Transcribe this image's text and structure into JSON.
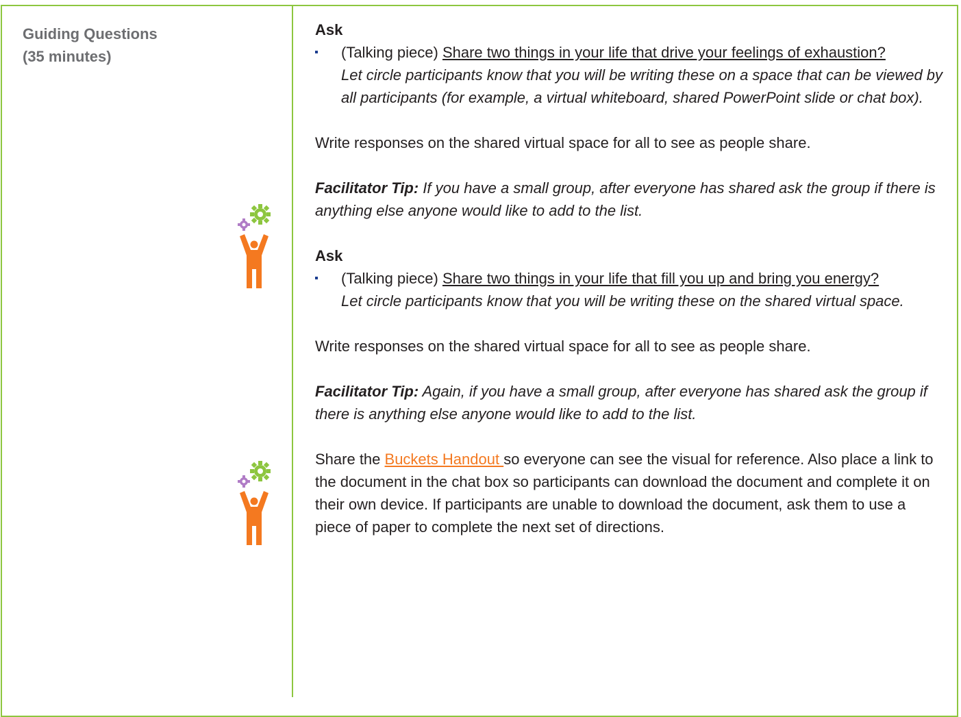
{
  "section": {
    "title": "Guiding Questions",
    "duration": "(35 minutes)"
  },
  "blocks": {
    "ask1": {
      "heading": "Ask",
      "prefix": "(Talking piece) ",
      "question": "Share two things in your life that drive your feelings of exhaustion? ",
      "note": "Let circle participants know that you will be writing these on a space that can be viewed by all participants (for example, a virtual whiteboard, shared PowerPoint slide or chat box)."
    },
    "write1": "Write responses on the shared virtual space for all to see as people share.",
    "tip1": {
      "label": "Facilitator Tip:",
      "text": " If you have a small group, after everyone has shared ask the group if there is anything else anyone would like to add to the list."
    },
    "ask2": {
      "heading": "Ask",
      "prefix": "(Talking piece) ",
      "question": "Share two things in your life that fill you up and bring you energy?",
      "note": "Let circle participants know that you will be writing these on the shared virtual space."
    },
    "write2": "Write responses on the shared virtual space for all to see as people share.",
    "tip2": {
      "label": "Facilitator Tip:",
      "text": " Again, if you have a small group, after everyone has shared ask the group if there is anything else anyone would like to add to the list."
    },
    "share": {
      "before": "Share the ",
      "link": "Buckets Handout ",
      "after": "so everyone can see the visual for reference. Also place a link to the document in the chat box so participants can download the document and complete it on their own device. If participants are unable to download the document, ask them to use a piece of paper to complete the next set of directions."
    }
  },
  "icons": {
    "facilitator": "facilitator-tip-icon",
    "colors": {
      "person": "#f47920",
      "big_gear": "#8dc63f",
      "small_gear": "#b07cc6"
    }
  },
  "colors": {
    "border": "#8dc63f",
    "link": "#f47920",
    "bullet": "#1b3d8f",
    "section_title": "#6d6e71"
  }
}
